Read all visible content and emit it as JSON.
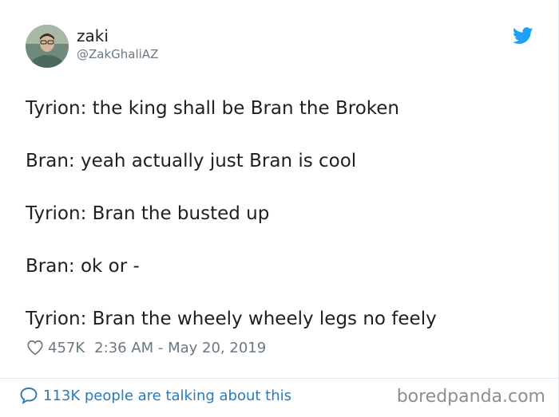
{
  "user": {
    "name": "zaki",
    "handle": "@ZakGhaliAZ"
  },
  "tweet": {
    "lines": [
      "Tyrion: the king shall be Bran the Broken",
      "Bran: yeah actually just Bran is cool",
      "Tyrion: Bran the busted up",
      "Bran: ok or -",
      "Tyrion: Bran the wheely wheely legs no feely"
    ],
    "likes": "457K",
    "timestamp": "2:36 AM - May 20, 2019"
  },
  "footer": {
    "conversation_label": "113K people are talking about this"
  },
  "watermark": "boredpanda.com",
  "colors": {
    "text": "#1c2022",
    "secondary": "#697882",
    "link": "#2b7bb9",
    "twitter_blue": "#1da1f2",
    "divider": "#e1e8ed"
  },
  "icons": {
    "logo": "twitter-bird-icon",
    "like": "heart-icon",
    "conversation": "speech-bubble-icon"
  }
}
